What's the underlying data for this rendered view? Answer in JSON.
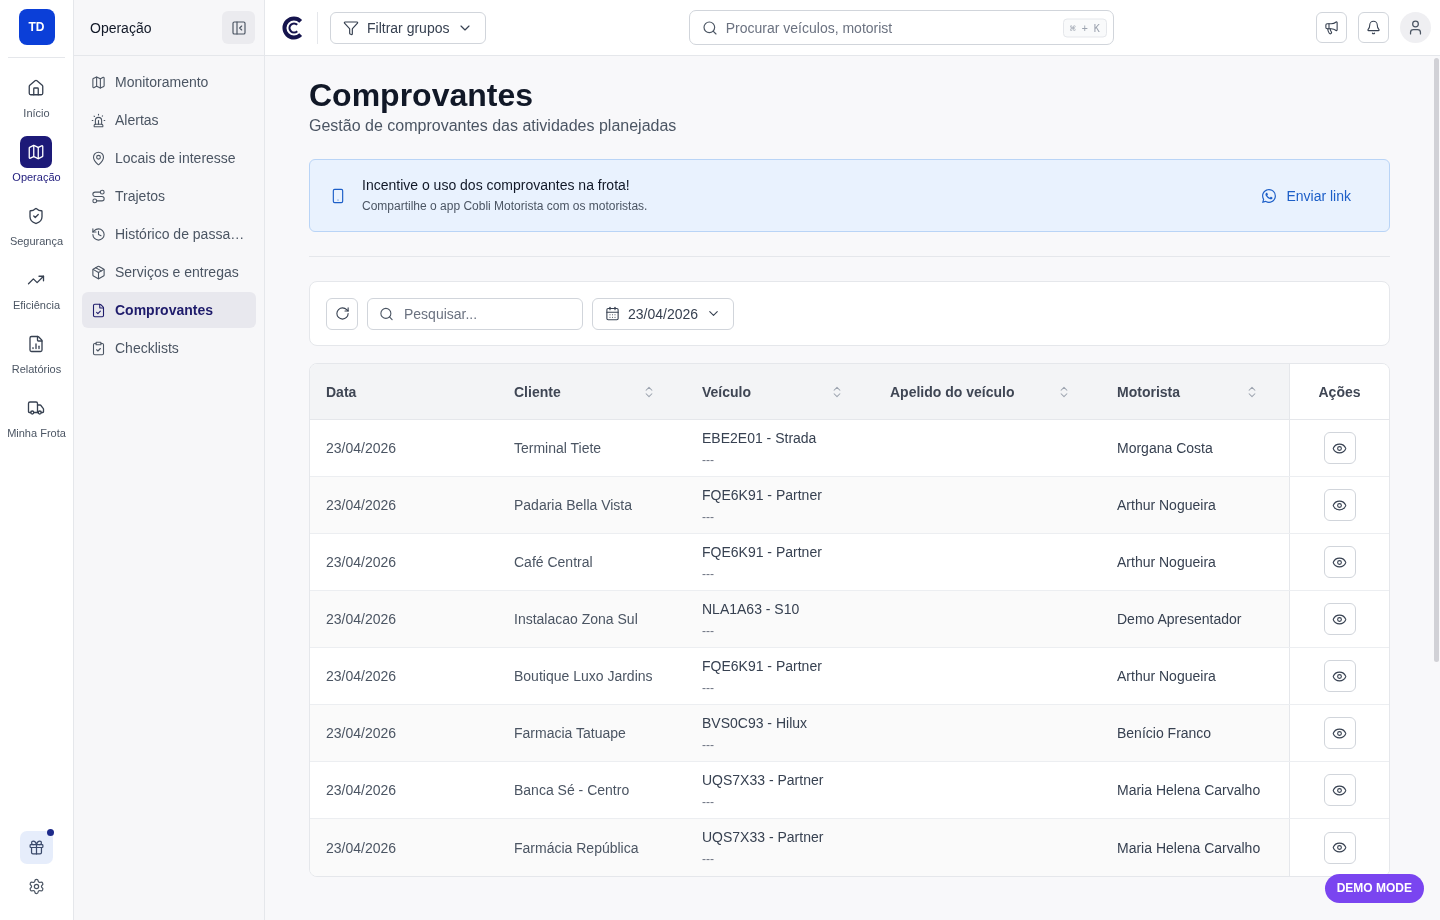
{
  "rail": {
    "avatar": "TD",
    "items": [
      {
        "label": "Início",
        "selected": false
      },
      {
        "label": "Operação",
        "selected": true
      },
      {
        "label": "Segurança",
        "selected": false
      },
      {
        "label": "Eficiência",
        "selected": false
      },
      {
        "label": "Relatórios",
        "selected": false
      },
      {
        "label": "Minha Frota",
        "selected": false
      }
    ],
    "gift_badge": true
  },
  "sidebar": {
    "title": "Operação",
    "items": [
      {
        "label": "Monitoramento",
        "selected": false
      },
      {
        "label": "Alertas",
        "selected": false
      },
      {
        "label": "Locais de interesse",
        "selected": false
      },
      {
        "label": "Trajetos",
        "selected": false
      },
      {
        "label": "Histórico de passa…",
        "selected": false
      },
      {
        "label": "Serviços e entregas",
        "selected": false
      },
      {
        "label": "Comprovantes",
        "selected": true
      },
      {
        "label": "Checklists",
        "selected": false
      }
    ]
  },
  "topbar": {
    "filter_button": "Filtrar grupos",
    "search": {
      "placeholder": "Procurar veículos, motorist",
      "shortcut": "⌘ + K"
    }
  },
  "page": {
    "title": "Comprovantes",
    "subtitle": "Gestão de comprovantes das atividades planejadas"
  },
  "banner": {
    "title": "Incentive o uso dos comprovantes na frota!",
    "text": "Compartilhe o app Cobli Motorista com os motoristas.",
    "link": "Enviar link"
  },
  "filters": {
    "search": {
      "placeholder": "Pesquisar..."
    },
    "date": "23/04/2026"
  },
  "table": {
    "columns": [
      {
        "label": "Data",
        "kind": "text",
        "sortable": false
      },
      {
        "label": "Cliente",
        "kind": "text",
        "sortable": true
      },
      {
        "label": "Veículo",
        "kind": "text",
        "sortable": true
      },
      {
        "label": "Apelido do veículo",
        "kind": "text",
        "sortable": true
      },
      {
        "label": "Motorista",
        "kind": "text",
        "sortable": true
      },
      {
        "label": "Ações",
        "kind": "actions",
        "sortable": false
      }
    ],
    "rows": [
      {
        "date": "23/04/2026",
        "client": "Terminal Tiete",
        "vehicle": "EBE2E01 - Strada",
        "vehicle_note": "---",
        "driver": "Morgana Costa"
      },
      {
        "date": "23/04/2026",
        "client": "Padaria Bella Vista",
        "vehicle": "FQE6K91 - Partner",
        "vehicle_note": "---",
        "driver": "Arthur Nogueira"
      },
      {
        "date": "23/04/2026",
        "client": "Café Central",
        "vehicle": "FQE6K91 - Partner",
        "vehicle_note": "---",
        "driver": "Arthur Nogueira"
      },
      {
        "date": "23/04/2026",
        "client": "Instalacao Zona Sul",
        "vehicle": "NLA1A63 - S10",
        "vehicle_note": "---",
        "driver": "Demo Apresentador"
      },
      {
        "date": "23/04/2026",
        "client": "Boutique Luxo Jardins",
        "vehicle": "FQE6K91 - Partner",
        "vehicle_note": "---",
        "driver": "Arthur Nogueira"
      },
      {
        "date": "23/04/2026",
        "client": "Farmacia Tatuape",
        "vehicle": "BVS0C93 - Hilux",
        "vehicle_note": "---",
        "driver": "Benício Franco"
      },
      {
        "date": "23/04/2026",
        "client": "Banca Sé - Centro",
        "vehicle": "UQS7X33 - Partner",
        "vehicle_note": "---",
        "driver": "Maria Helena Carvalho"
      },
      {
        "date": "23/04/2026",
        "client": "Farmácia República",
        "vehicle": "UQS7X33 - Partner",
        "vehicle_note": "---",
        "driver": "Maria Helena Carvalho"
      }
    ]
  },
  "demo_badge": "DEMO MODE"
}
